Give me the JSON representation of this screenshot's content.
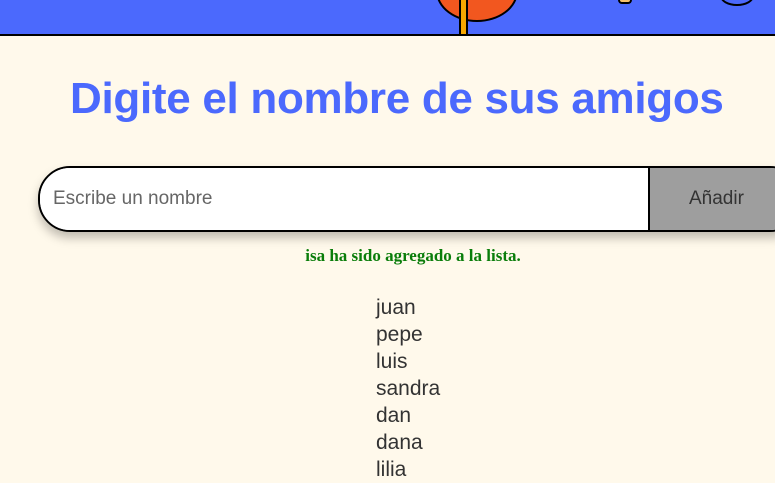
{
  "header": {
    "title": "Digite el nombre de sus amigos"
  },
  "form": {
    "input_placeholder": "Escribe un nombre",
    "input_value": "",
    "add_button_label": "Añadir"
  },
  "status": {
    "message": "isa ha sido agregado a la lista.",
    "color": "#0a7d0a"
  },
  "friends": [
    "juan",
    "pepe",
    "luis",
    "sandra",
    "dan",
    "dana",
    "lilia"
  ],
  "colors": {
    "background": "#fff9eb",
    "accent": "#4b69fd",
    "button": "#9e9e9e"
  }
}
